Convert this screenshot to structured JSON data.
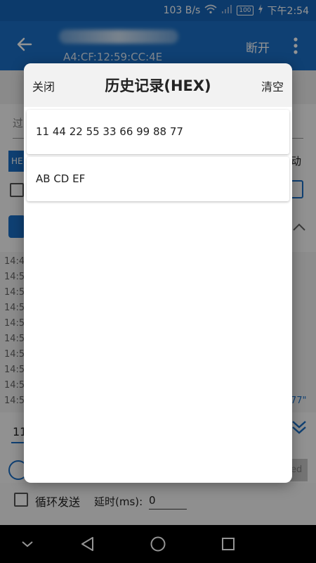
{
  "status_bar": {
    "speed": "103 B/s",
    "battery": "100",
    "time": "下午2:54",
    "icons": [
      "wifi-icon",
      "signal-icon",
      "battery-icon",
      "charging-icon"
    ]
  },
  "app_bar": {
    "mac_address": "A4:CF:12:59:CC:4E",
    "disconnect_label": "断开"
  },
  "background": {
    "log_times": [
      "14:4",
      "14:5",
      "14:5",
      "14:5",
      "14:5",
      "14:5",
      "14:5",
      "14:5",
      "14:5",
      "14:5"
    ],
    "filter_hint": "过",
    "hex_tag": "HE",
    "auto_label": "动",
    "log_tail": "77\"",
    "input_prefix": "11",
    "send_label": "ed",
    "loop_label": "循环发送",
    "delay_label": "延时(ms):",
    "delay_value": "0"
  },
  "dialog": {
    "close_label": "关闭",
    "title": "历史记录(HEX)",
    "clear_label": "清空",
    "items": [
      {
        "text": "11 44 22 55 33 66 99 88 77"
      },
      {
        "text": "AB CD EF"
      }
    ]
  },
  "colors": {
    "primary": "#1a6fc6",
    "status_bar": "#1565b8"
  }
}
